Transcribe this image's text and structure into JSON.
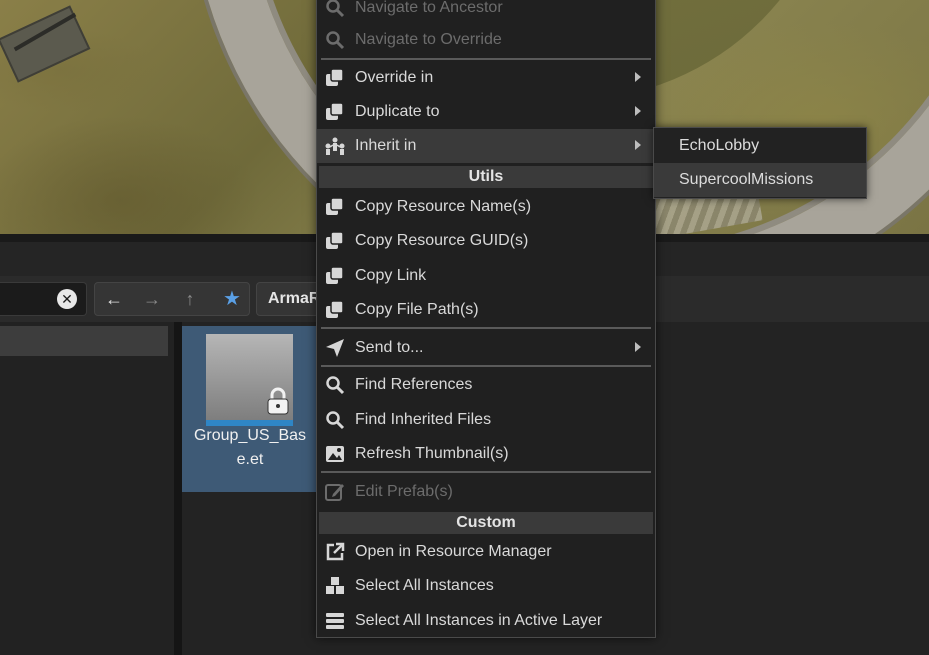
{
  "toolbar": {
    "clear_glyph": "✕",
    "back_glyph": "←",
    "forward_glyph": "→",
    "up_glyph": "↑",
    "favorite_glyph": "★",
    "path_root": "ArmaR"
  },
  "file": {
    "name": "Group_US_Base.et",
    "locked_icon": "lock-icon"
  },
  "menu": {
    "items": [
      {
        "label": "Navigate to Ancestor",
        "icon": "search-icon",
        "disabled": true
      },
      {
        "label": "Navigate to Override",
        "icon": "search-icon",
        "disabled": true
      },
      {
        "label": "Override in",
        "icon": "copy-icon",
        "submenu": true
      },
      {
        "label": "Duplicate to",
        "icon": "copy-icon",
        "submenu": true
      },
      {
        "label": "Inherit in",
        "icon": "inherit-icon",
        "submenu": true,
        "highlighted": true
      },
      {
        "label": "Copy Resource Name(s)",
        "icon": "copy-icon"
      },
      {
        "label": "Copy Resource GUID(s)",
        "icon": "copy-icon"
      },
      {
        "label": "Copy Link",
        "icon": "copy-icon"
      },
      {
        "label": "Copy File Path(s)",
        "icon": "copy-icon"
      },
      {
        "label": "Send to...",
        "icon": "send-icon",
        "submenu": true
      },
      {
        "label": "Find References",
        "icon": "search-icon"
      },
      {
        "label": "Find Inherited Files",
        "icon": "search-icon"
      },
      {
        "label": "Refresh Thumbnail(s)",
        "icon": "image-icon"
      },
      {
        "label": "Edit Prefab(s)",
        "icon": "edit-icon",
        "disabled": true
      },
      {
        "label": "Open in Resource Manager",
        "icon": "external-link-icon"
      },
      {
        "label": "Select All Instances",
        "icon": "cubes-icon"
      },
      {
        "label": "Select All Instances in Active Layer",
        "icon": "layers-icon"
      }
    ],
    "sections": {
      "utils": "Utils",
      "custom": "Custom"
    }
  },
  "submenu": {
    "items": [
      {
        "label": "EchoLobby"
      },
      {
        "label": "SupercoolMissions",
        "highlighted": true
      }
    ]
  },
  "colors": {
    "accent": "#2f86c6",
    "menu_bg": "#202020",
    "highlight": "#3a3a3a",
    "favorite": "#5aa0e6"
  }
}
